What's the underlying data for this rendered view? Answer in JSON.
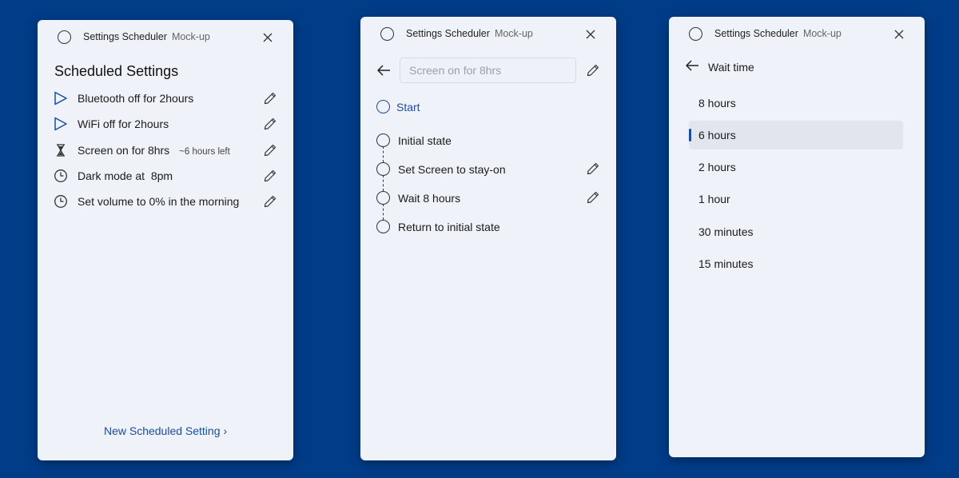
{
  "colors": {
    "desktop_background": "#003c88",
    "window_background": "#eff2f8",
    "accent": "#1a4da0",
    "selected_background": "#e2e5ee"
  },
  "window1": {
    "app_title": "Settings Scheduler",
    "app_subtitle": "Mock-up",
    "heading": "Scheduled Settings",
    "items": [
      {
        "icon": "play-icon",
        "label": "Bluetooth off for 2hours",
        "note": ""
      },
      {
        "icon": "play-icon",
        "label": "WiFi off for 2hours",
        "note": ""
      },
      {
        "icon": "hourglass-icon",
        "label": "Screen on for 8hrs",
        "note": "~6 hours left"
      },
      {
        "icon": "clock-icon",
        "label": "Dark mode at  8pm",
        "note": ""
      },
      {
        "icon": "clock-icon",
        "label": "Set volume to 0% in the morning",
        "note": ""
      }
    ],
    "new_link": "New Scheduled Setting ›"
  },
  "window2": {
    "app_title": "Settings Scheduler",
    "app_subtitle": "Mock-up",
    "name_placeholder": "Screen on for 8hrs",
    "start_label": "Start",
    "steps": [
      {
        "label": "Initial state",
        "editable": false
      },
      {
        "label": "Set Screen to stay-on",
        "editable": true
      },
      {
        "label": "Wait 8 hours",
        "editable": true
      },
      {
        "label": "Return to initial state",
        "editable": false
      }
    ]
  },
  "window3": {
    "app_title": "Settings Scheduler",
    "app_subtitle": "Mock-up",
    "header": "Wait time",
    "options": [
      "8 hours",
      "6 hours",
      "2 hours",
      "1 hour",
      "30 minutes",
      "15 minutes"
    ],
    "selected": "6 hours"
  }
}
